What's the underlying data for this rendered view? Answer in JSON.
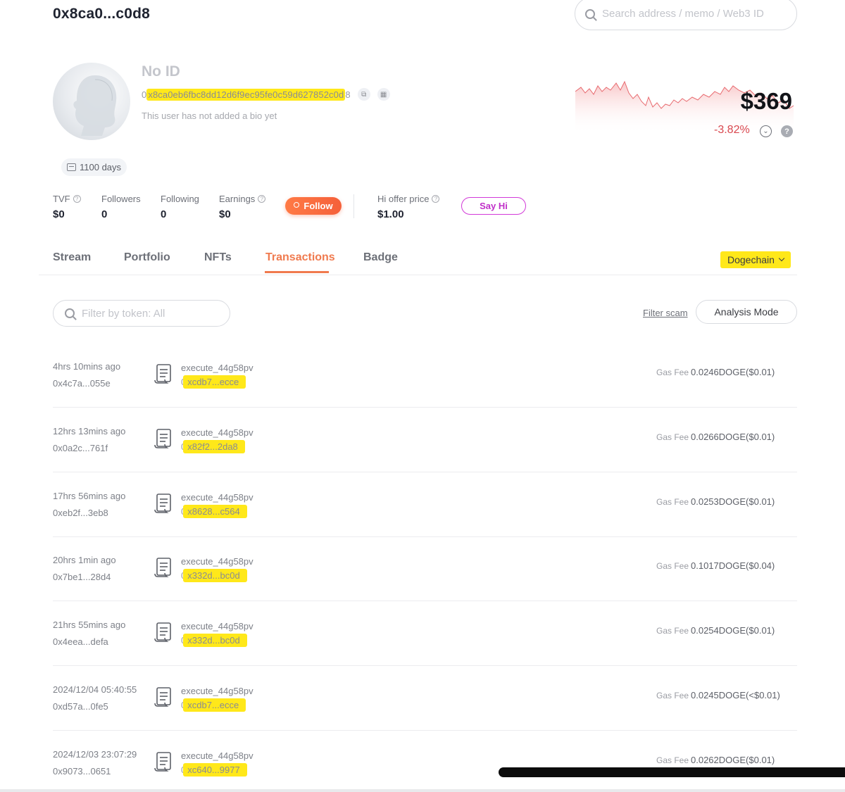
{
  "header": {
    "title": "0x8ca0...c0d8",
    "search_placeholder": "Search address / memo / Web3 ID"
  },
  "profile": {
    "name": "No ID",
    "address_prefix": "0",
    "address_highlight": "x8ca0eb6fbc8dd12d6f9ec95fe0c59d627852c0d",
    "address_suffix": "8",
    "bio": "This user has not added a bio yet",
    "days": "1100 days",
    "icons": [
      "avatar-silhouette",
      "copy-icon",
      "qr-code-icon",
      "calendar-icon"
    ]
  },
  "price_widget": {
    "price": "$369",
    "change": "-3.82%",
    "accent_color": "#d9484f",
    "icons": [
      "chevron-circle-icon",
      "help-icon"
    ]
  },
  "stats": {
    "tvf_label": "TVF",
    "tvf_value": "$0",
    "followers_label": "Followers",
    "followers_value": "0",
    "following_label": "Following",
    "following_value": "0",
    "earnings_label": "Earnings",
    "earnings_value": "$0",
    "follow_label": "Follow",
    "hi_offer_label": "Hi offer price",
    "hi_offer_value": "$1.00",
    "say_hi_label": "Say Hi"
  },
  "tabs": [
    {
      "label": "Stream"
    },
    {
      "label": "Portfolio"
    },
    {
      "label": "NFTs"
    },
    {
      "label": "Transactions"
    },
    {
      "label": "Badge"
    }
  ],
  "active_tab": "Transactions",
  "chain": "Dogechain",
  "filters": {
    "token_placeholder": "Filter by token: All",
    "filter_scam": "Filter scam",
    "analysis_mode": "Analysis Mode"
  },
  "transactions": [
    {
      "time": "4hrs 10mins ago",
      "from": "0x4c7a...055e",
      "method": "execute_44g58pv",
      "to_prefix": "0",
      "to_highlight": "xcdb7...ecce",
      "gas_label": "Gas Fee",
      "gas": "0.0246DOGE($0.01)"
    },
    {
      "time": "12hrs 13mins ago",
      "from": "0x0a2c...761f",
      "method": "execute_44g58pv",
      "to_prefix": "0",
      "to_highlight": "x82f2...2da8",
      "gas_label": "Gas Fee",
      "gas": "0.0266DOGE($0.01)"
    },
    {
      "time": "17hrs 56mins ago",
      "from": "0xeb2f...3eb8",
      "method": "execute_44g58pv",
      "to_prefix": "0",
      "to_highlight": "x8628...c564",
      "gas_label": "Gas Fee",
      "gas": "0.0253DOGE($0.01)"
    },
    {
      "time": "20hrs 1min ago",
      "from": "0x7be1...28d4",
      "method": "execute_44g58pv",
      "to_prefix": "0",
      "to_highlight": "x332d...bc0d",
      "gas_label": "Gas Fee",
      "gas": "0.1017DOGE($0.04)"
    },
    {
      "time": "21hrs 55mins ago",
      "from": "0x4eea...defa",
      "method": "execute_44g58pv",
      "to_prefix": "0",
      "to_highlight": "x332d...bc0d",
      "gas_label": "Gas Fee",
      "gas": "0.0254DOGE($0.01)"
    },
    {
      "time": "2024/12/04 05:40:55",
      "from": "0xd57a...0fe5",
      "method": "execute_44g58pv",
      "to_prefix": "0",
      "to_highlight": "xcdb7...ecce",
      "gas_label": "Gas Fee",
      "gas": "0.0245DOGE(<$0.01)"
    },
    {
      "time": "2024/12/03 23:07:29",
      "from": "0x9073...0651",
      "method": "execute_44g58pv",
      "to_prefix": "0",
      "to_highlight": "xc640...9977",
      "gas_label": "Gas Fee",
      "gas": "0.0262DOGE($0.01)"
    }
  ],
  "colors": {
    "accent_orange": "#f07a4e",
    "highlight_yellow": "#ffe81a",
    "say_hi_magenta": "#c02fc8",
    "sparkline_red": "#e86a6f"
  }
}
